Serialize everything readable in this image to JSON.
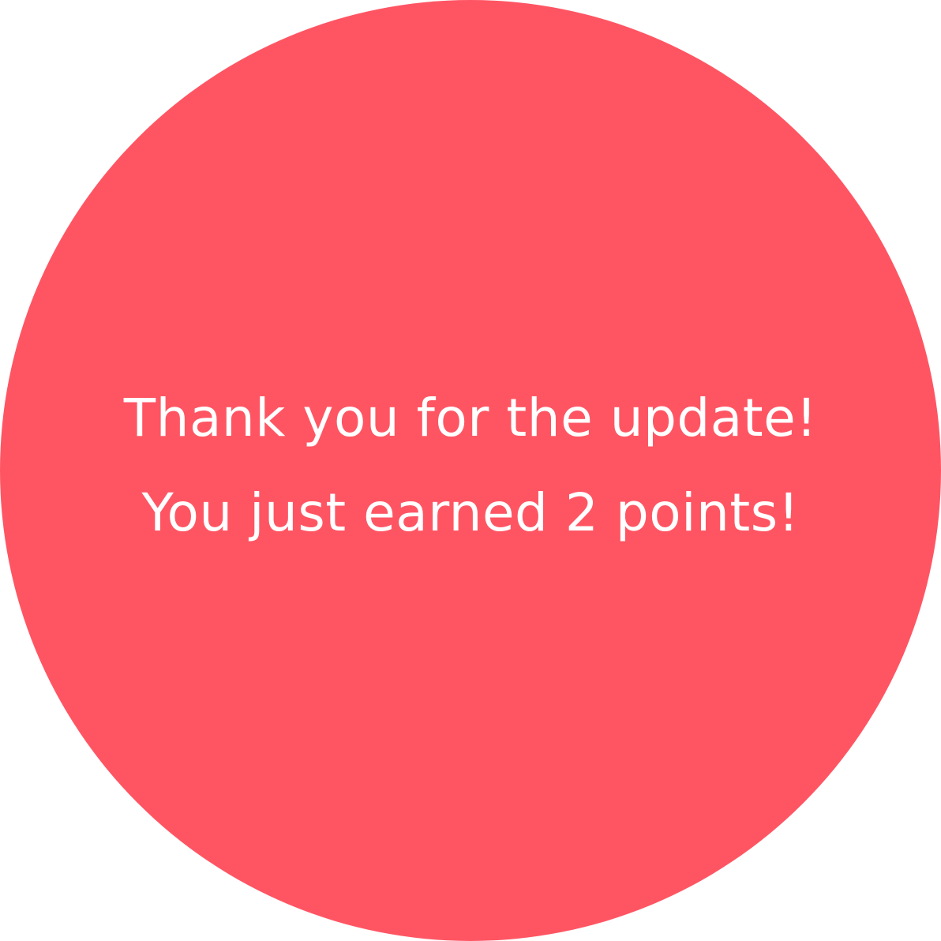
{
  "toast": {
    "background_color": "#FF5563",
    "text_color": "#FFFFFF",
    "title": "Thank you for the update!",
    "message": "You just earned 2 points!"
  }
}
